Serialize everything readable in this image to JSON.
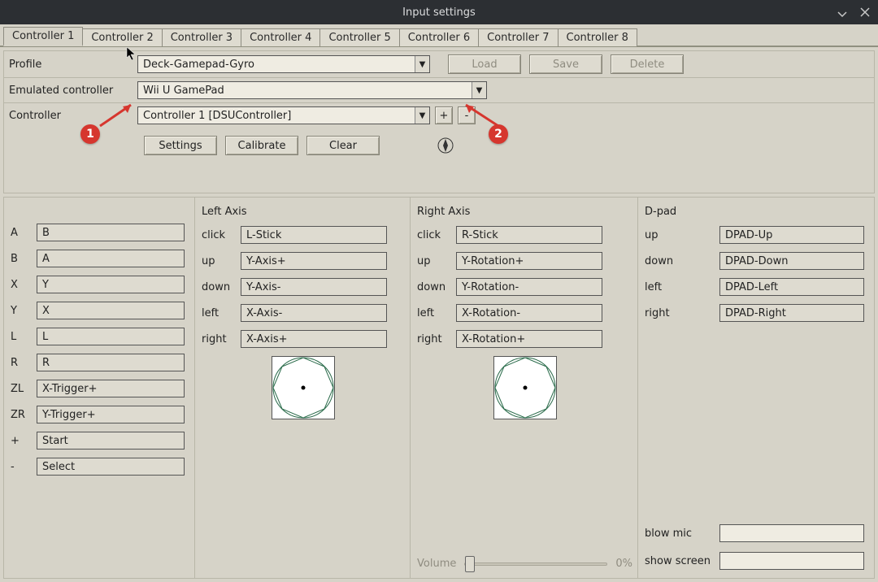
{
  "window": {
    "title": "Input settings"
  },
  "tabs": [
    "Controller 1",
    "Controller 2",
    "Controller 3",
    "Controller 4",
    "Controller 5",
    "Controller 6",
    "Controller 7",
    "Controller 8"
  ],
  "active_tab": 0,
  "profile": {
    "label": "Profile",
    "value": "Deck-Gamepad-Gyro",
    "load": "Load",
    "save": "Save",
    "delete": "Delete"
  },
  "emulated": {
    "label": "Emulated controller",
    "value": "Wii U GamePad"
  },
  "controller": {
    "label": "Controller",
    "value": "Controller 1 [DSUController]",
    "plus": "+",
    "minus": "-"
  },
  "actions": {
    "settings": "Settings",
    "calibrate": "Calibrate",
    "clear": "Clear"
  },
  "buttons": [
    {
      "label": "A",
      "value": "B"
    },
    {
      "label": "B",
      "value": "A"
    },
    {
      "label": "X",
      "value": "Y"
    },
    {
      "label": "Y",
      "value": "X"
    },
    {
      "label": "L",
      "value": "L"
    },
    {
      "label": "R",
      "value": "R"
    },
    {
      "label": "ZL",
      "value": "X-Trigger+"
    },
    {
      "label": "ZR",
      "value": "Y-Trigger+"
    },
    {
      "label": "+",
      "value": "Start"
    },
    {
      "label": "-",
      "value": "Select"
    }
  ],
  "left_axis": {
    "title": "Left Axis",
    "rows": [
      {
        "label": "click",
        "value": "L-Stick"
      },
      {
        "label": "up",
        "value": "Y-Axis+"
      },
      {
        "label": "down",
        "value": "Y-Axis-"
      },
      {
        "label": "left",
        "value": "X-Axis-"
      },
      {
        "label": "right",
        "value": "X-Axis+"
      }
    ]
  },
  "right_axis": {
    "title": "Right Axis",
    "rows": [
      {
        "label": "click",
        "value": "R-Stick"
      },
      {
        "label": "up",
        "value": "Y-Rotation+"
      },
      {
        "label": "down",
        "value": "Y-Rotation-"
      },
      {
        "label": "left",
        "value": "X-Rotation-"
      },
      {
        "label": "right",
        "value": "X-Rotation+"
      }
    ],
    "volume_label": "Volume",
    "volume_pct": "0%"
  },
  "dpad": {
    "title": "D-pad",
    "rows": [
      {
        "label": "up",
        "value": "DPAD-Up"
      },
      {
        "label": "down",
        "value": "DPAD-Down"
      },
      {
        "label": "left",
        "value": "DPAD-Left"
      },
      {
        "label": "right",
        "value": "DPAD-Right"
      }
    ],
    "blow_mic": "blow mic",
    "show_screen": "show screen"
  },
  "annotations": {
    "marker1": "1",
    "marker2": "2"
  }
}
